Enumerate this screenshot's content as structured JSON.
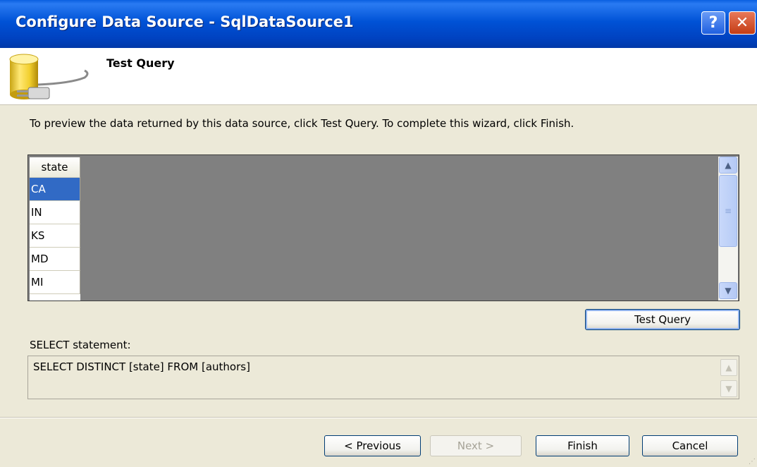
{
  "window": {
    "title": "Configure Data Source - SqlDataSource1",
    "help_label": "?",
    "close_label": "✕"
  },
  "header": {
    "title": "Test Query",
    "icon": "database-plug-icon"
  },
  "instruction": "To preview the data returned by this data source, click Test Query. To complete this wizard, click Finish.",
  "grid": {
    "column_header": "state",
    "rows": [
      "CA",
      "IN",
      "KS",
      "MD",
      "MI"
    ],
    "selected_row": "CA"
  },
  "test_query_button": "Test Query",
  "select_statement": {
    "label": "SELECT statement:",
    "value": "SELECT DISTINCT [state] FROM [authors]"
  },
  "footer": {
    "previous_label": "< Previous",
    "next_label": "Next >",
    "finish_label": "Finish",
    "cancel_label": "Cancel"
  },
  "colors": {
    "titlebar": "#0052d6",
    "selection": "#316ac5",
    "dialog_background": "#ece9d8"
  }
}
